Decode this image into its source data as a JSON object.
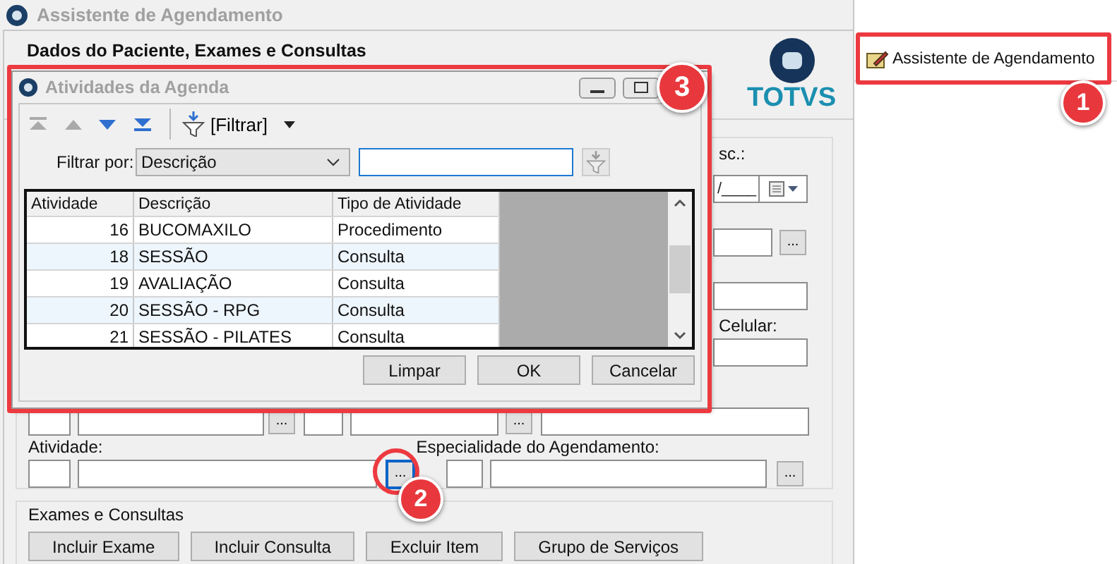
{
  "main_window": {
    "title": "Assistente de Agendamento",
    "heading": "Dados do Paciente, Exames e Consultas",
    "logo_text": "TOTVS",
    "form": {
      "date_label": "sc.:",
      "date_value": "/____",
      "cell_label": "Celular:",
      "activity_label": "Atividade:",
      "specialty_label": "Especialidade do Agendamento:",
      "lookup_buttons": [
        {
          "label": "...",
          "highlighted": false
        },
        {
          "label": "...",
          "highlighted": false
        },
        {
          "label": "...",
          "highlighted": false
        },
        {
          "label": "...",
          "highlighted": true
        },
        {
          "label": "...",
          "highlighted": false
        }
      ]
    },
    "exams_group": {
      "title": "Exames e Consultas",
      "buttons": [
        "Incluir Exame",
        "Incluir Consulta",
        "Excluir Item",
        "Grupo de Serviços"
      ]
    }
  },
  "side_panel": {
    "item": "Assistente de Agendamento"
  },
  "dialog": {
    "title": "Atividades da Agenda",
    "filter_button": "[Filtrar]",
    "filter_label": "Filtrar por:",
    "filter_field": "Descrição",
    "grid": {
      "columns": [
        "Atividade",
        "Descrição",
        "Tipo de Atividade"
      ],
      "rows": [
        [
          "16",
          "BUCOMAXILO",
          "Procedimento"
        ],
        [
          "18",
          "SESSÃO",
          "Consulta"
        ],
        [
          "19",
          "AVALIAÇÃO",
          "Consulta"
        ],
        [
          "20",
          "SESSÃO - RPG",
          "Consulta"
        ],
        [
          "21",
          "SESSÃO - PILATES",
          "Consulta"
        ]
      ]
    },
    "buttons": [
      "Limpar",
      "OK",
      "Cancelar"
    ]
  },
  "annotations": [
    "1",
    "2",
    "3"
  ]
}
